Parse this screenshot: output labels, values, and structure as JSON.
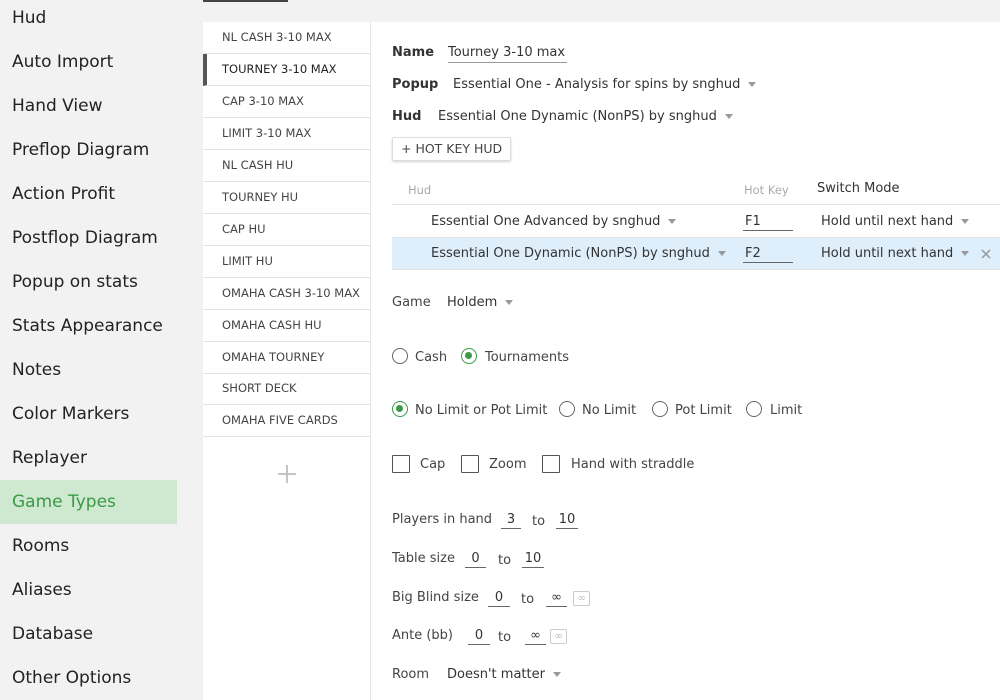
{
  "nav": {
    "items": [
      {
        "label": "Hud"
      },
      {
        "label": "Auto Import"
      },
      {
        "label": "Hand View"
      },
      {
        "label": "Preflop Diagram"
      },
      {
        "label": "Action Profit"
      },
      {
        "label": "Postflop Diagram"
      },
      {
        "label": "Popup on stats"
      },
      {
        "label": "Stats Appearance"
      },
      {
        "label": "Notes"
      },
      {
        "label": "Color Markers"
      },
      {
        "label": "Replayer"
      },
      {
        "label": "Game Types"
      },
      {
        "label": "Rooms"
      },
      {
        "label": "Aliases"
      },
      {
        "label": "Database"
      },
      {
        "label": "Other Options"
      }
    ],
    "active": "Game Types"
  },
  "game_types": {
    "items": [
      {
        "label": "NL CASH 3-10 MAX"
      },
      {
        "label": "TOURNEY 3-10 MAX"
      },
      {
        "label": "CAP 3-10 MAX"
      },
      {
        "label": "LIMIT 3-10 MAX"
      },
      {
        "label": "NL CASH HU"
      },
      {
        "label": "TOURNEY HU"
      },
      {
        "label": "CAP HU"
      },
      {
        "label": "LIMIT HU"
      },
      {
        "label": "OMAHA CASH 3-10 MAX"
      },
      {
        "label": "OMAHA CASH HU"
      },
      {
        "label": "OMAHA TOURNEY"
      },
      {
        "label": "SHORT DECK"
      },
      {
        "label": "OMAHA FIVE CARDS"
      }
    ],
    "selected": "TOURNEY 3-10 MAX",
    "add_icon": "plus-icon"
  },
  "form": {
    "name_label": "Name",
    "name_value": "Tourney 3-10 max",
    "popup_label": "Popup",
    "popup_value": "Essential One - Analysis for spins by snghud",
    "hud_label": "Hud",
    "hud_value": "Essential One Dynamic (NonPS) by snghud",
    "hotkey_button": "+ HOT KEY HUD",
    "hud_table": {
      "headers": {
        "hud": "Hud",
        "hot_key": "Hot Key",
        "switch_mode": "Switch Mode"
      },
      "rows": [
        {
          "hud": "Essential One Advanced by snghud",
          "hot_key": "F1",
          "switch_mode": "Hold until next hand"
        },
        {
          "hud": "Essential One Dynamic (NonPS) by snghud",
          "hot_key": "F2",
          "switch_mode": "Hold until next hand"
        }
      ]
    },
    "game_label": "Game",
    "game_value": "Holdem",
    "type_options": [
      {
        "label": "Cash",
        "checked": false
      },
      {
        "label": "Tournaments",
        "checked": true
      }
    ],
    "limit_options": [
      {
        "label": "No Limit or Pot Limit",
        "checked": true
      },
      {
        "label": "No Limit",
        "checked": false
      },
      {
        "label": "Pot Limit",
        "checked": false
      },
      {
        "label": "Limit",
        "checked": false
      }
    ],
    "checkboxes": [
      {
        "label": "Cap",
        "checked": false
      },
      {
        "label": "Zoom",
        "checked": false
      },
      {
        "label": "Hand with straddle",
        "checked": false
      }
    ],
    "to_label": "to",
    "players": {
      "label": "Players in hand",
      "from": "3",
      "to": "10"
    },
    "table_size": {
      "label": "Table size",
      "from": "0",
      "to": "10"
    },
    "big_blind": {
      "label": "Big Blind size",
      "from": "0",
      "to": "∞"
    },
    "ante": {
      "label": "Ante (bb)",
      "from": "0",
      "to": "∞"
    },
    "infinity_button": "∞",
    "room_label": "Room",
    "room_value": "Doesn't matter"
  },
  "colors": {
    "accent": "#3a9a45",
    "active_bg": "#cfe8d0",
    "selected_row": "#deeefb"
  }
}
